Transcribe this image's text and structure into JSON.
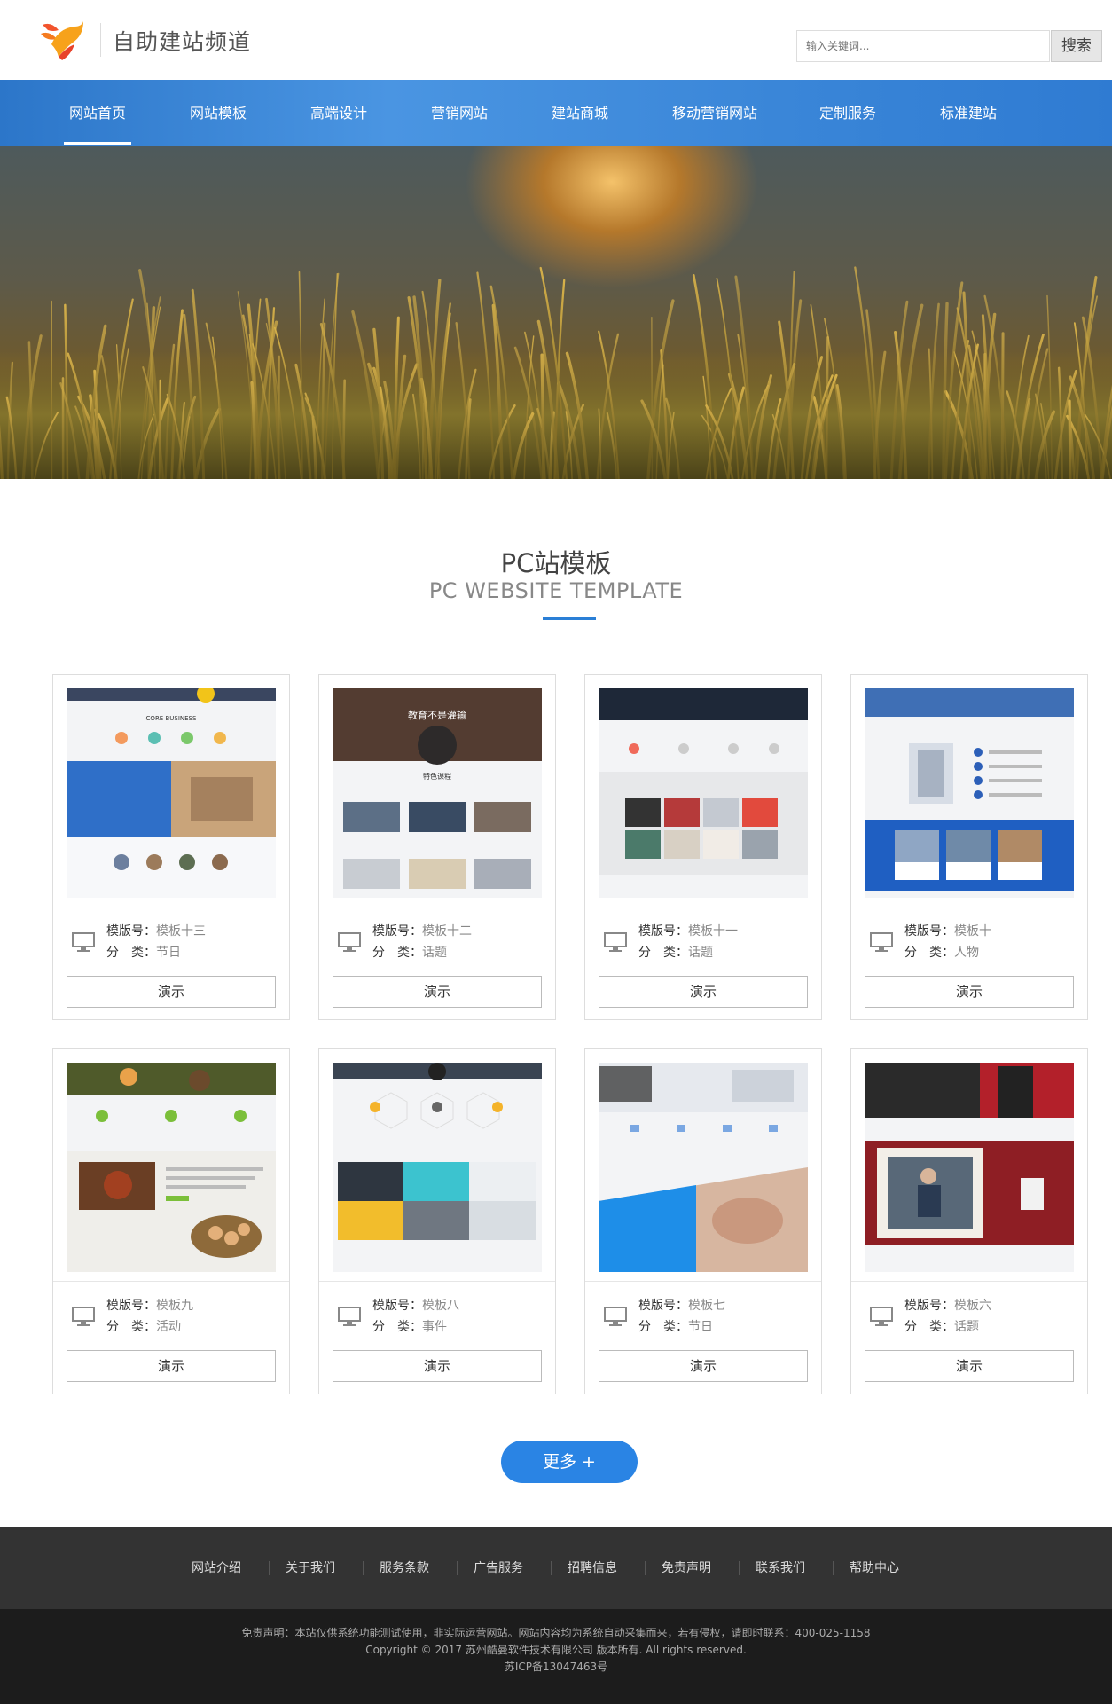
{
  "header": {
    "site_title": "自助建站频道",
    "search_placeholder": "输入关键词...",
    "search_button": "搜索"
  },
  "nav": {
    "items": [
      "网站首页",
      "网站模板",
      "高端设计",
      "营销网站",
      "建站商城",
      "移动营销网站",
      "定制服务",
      "标准建站"
    ],
    "active_index": 0
  },
  "banner": {
    "slides_count": 3,
    "active_slide": 1,
    "accent_color": "#2a7fd6"
  },
  "section": {
    "title": "PC站模板",
    "subtitle": "PC WEBSITE TEMPLATE"
  },
  "templates": {
    "label_id": "模版号：",
    "label_cat": "分　类：",
    "demo_label": "演示",
    "items": [
      {
        "name": "模板十三",
        "category": "节日"
      },
      {
        "name": "模板十二",
        "category": "话题"
      },
      {
        "name": "模板十一",
        "category": "话题"
      },
      {
        "name": "模板十",
        "category": "人物"
      },
      {
        "name": "模板九",
        "category": "活动"
      },
      {
        "name": "模板八",
        "category": "事件"
      },
      {
        "name": "模板七",
        "category": "节日"
      },
      {
        "name": "模板六",
        "category": "话题"
      }
    ],
    "thumb_texts": {
      "t13_core": "CORE BUSINESS",
      "t12_headline": "教育不是灌输",
      "t12_sub": "特色课程"
    }
  },
  "more_button": "更多 +",
  "footer": {
    "links": [
      "网站介绍",
      "关于我们",
      "服务条款",
      "广告服务",
      "招聘信息",
      "免责声明",
      "联系我们",
      "帮助中心"
    ],
    "disclaimer": "免责声明：本站仅供系统功能测试使用，非实际运营网站。网站内容均为系统自动采集而来，若有侵权，请即时联系：400-025-1158",
    "copyright": "Copyright © 2017 苏州酷曼软件技术有限公司 版本所有. All rights reserved.",
    "icp": "苏ICP备13047463号"
  },
  "colors": {
    "nav_blue": "#3a86d8",
    "accent": "#2a84e4",
    "footer_top": "#333333",
    "footer_bottom": "#1c1c1c"
  }
}
